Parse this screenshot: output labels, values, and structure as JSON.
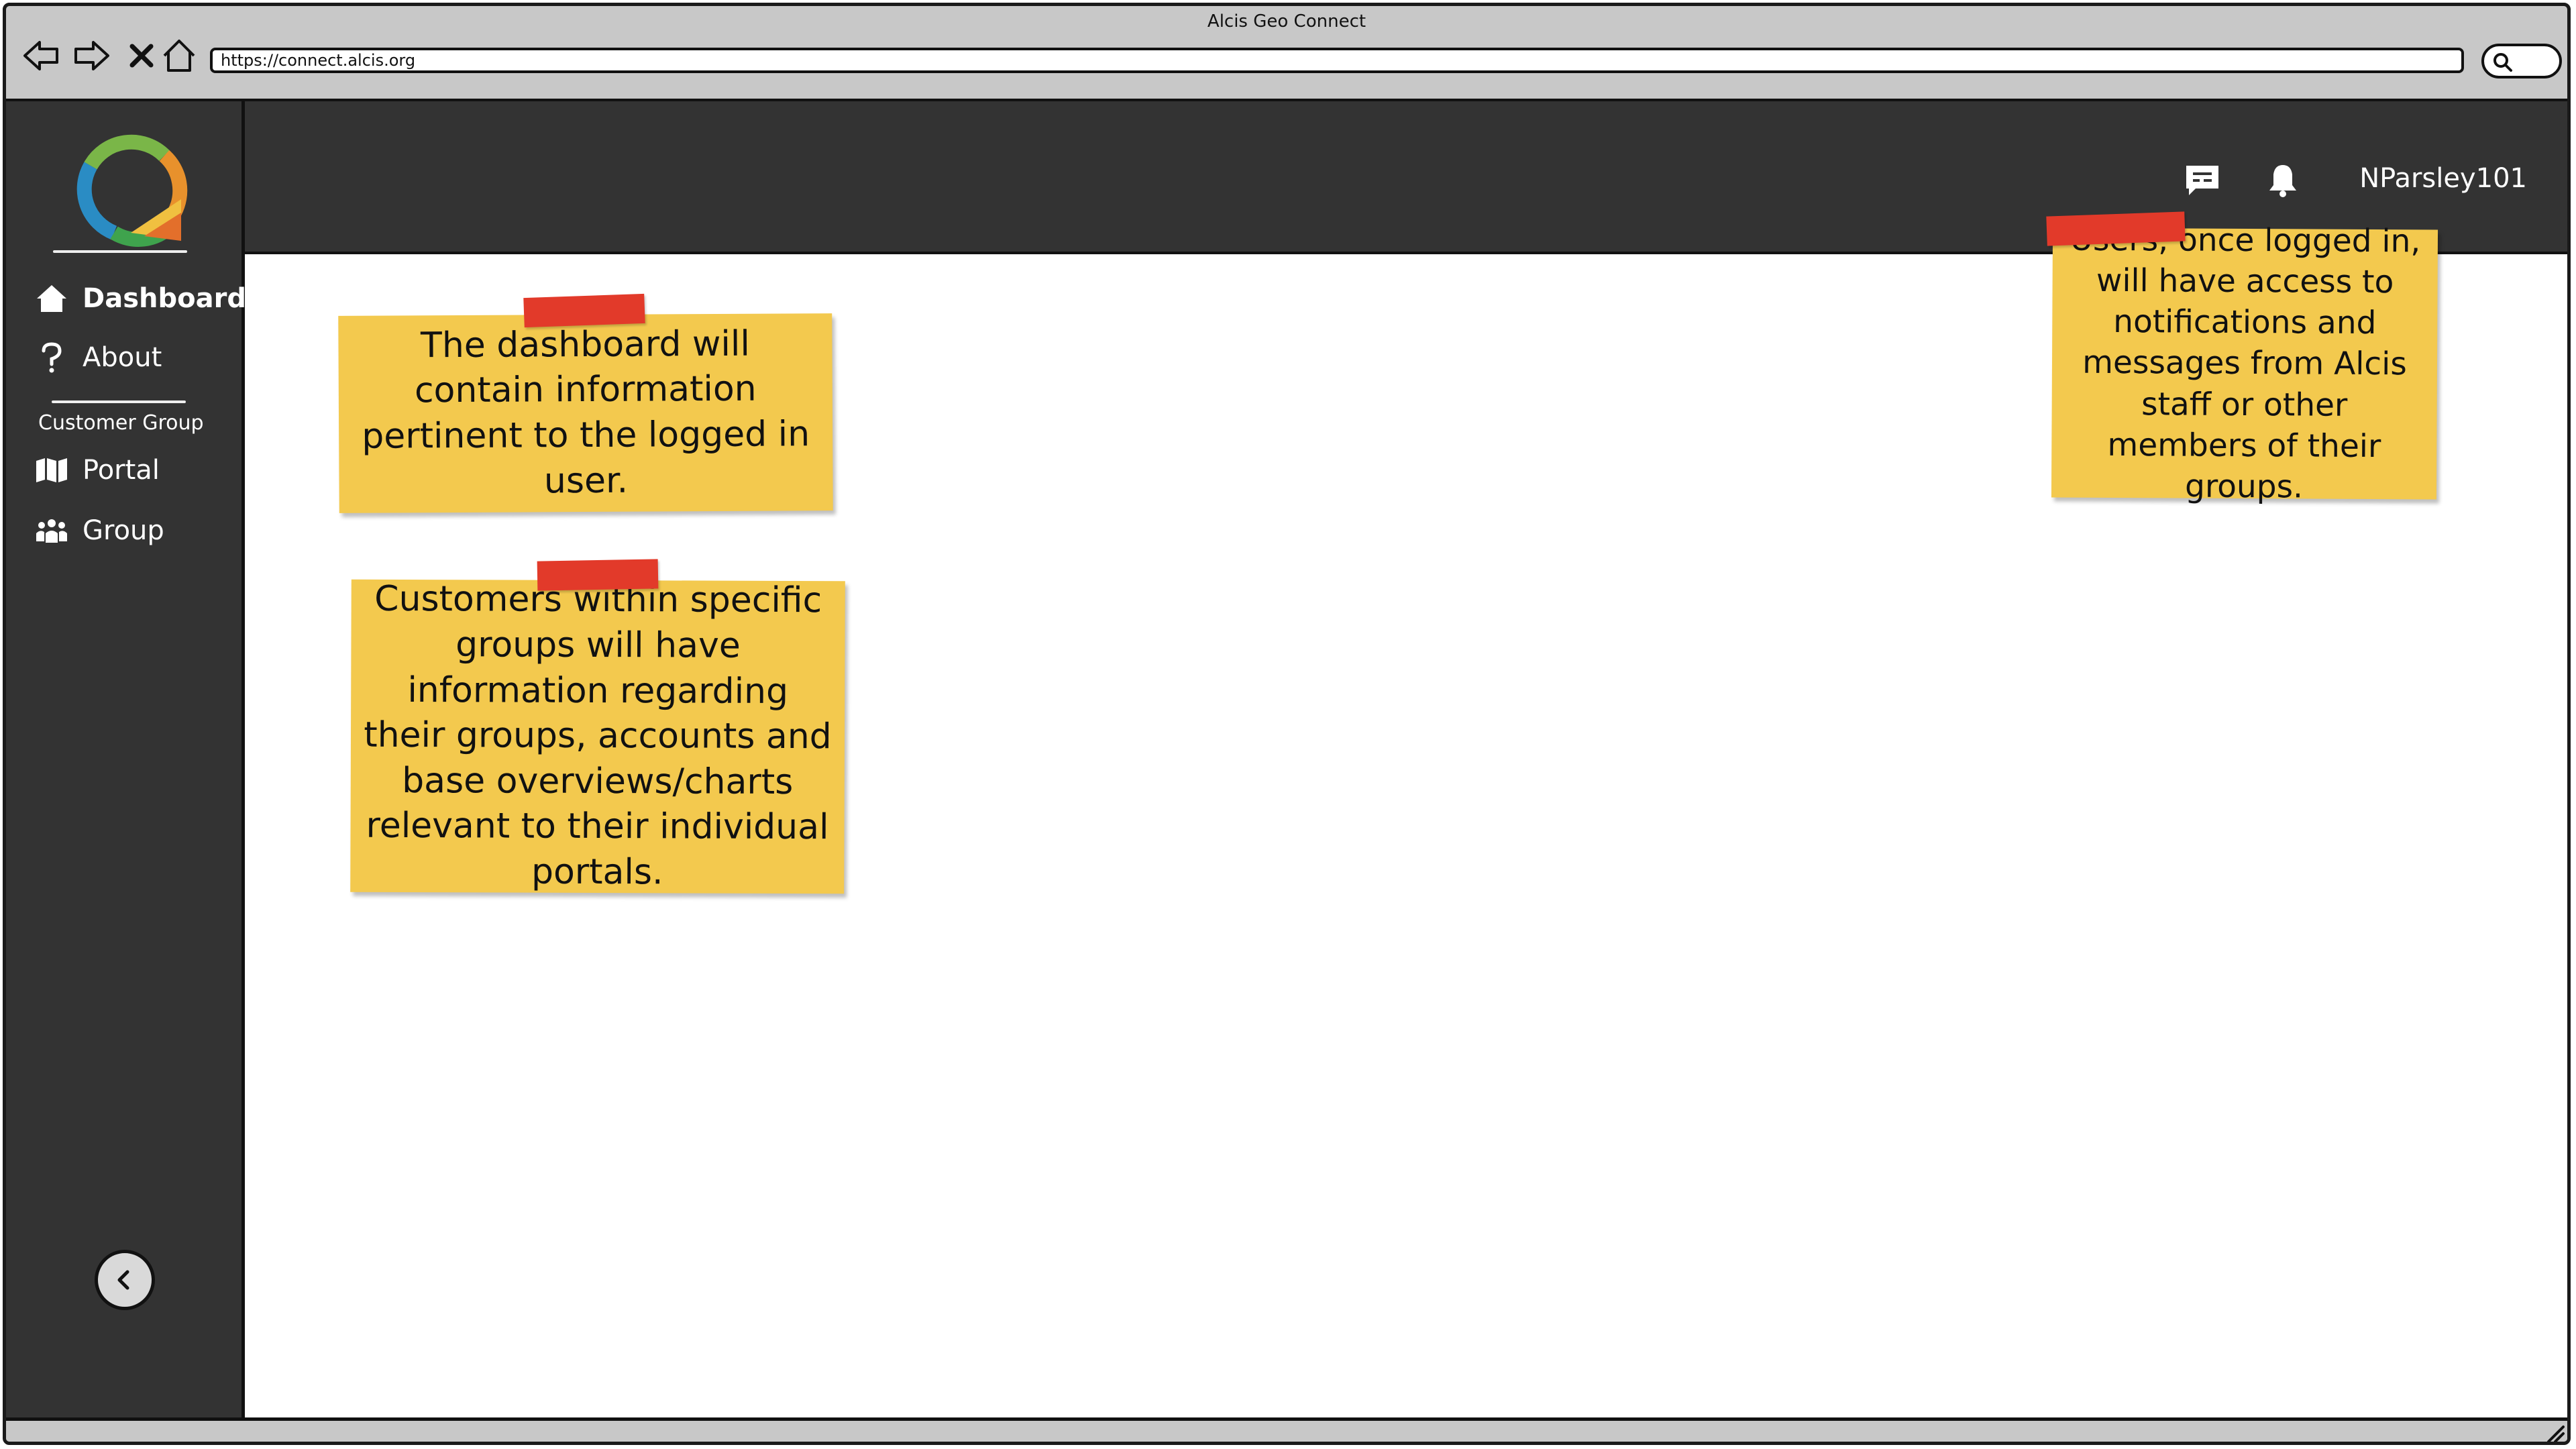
{
  "browser": {
    "window_title": "Alcis Geo Connect",
    "url": "https://connect.alcis.org",
    "nav_icons": [
      "back-arrow-icon",
      "forward-arrow-icon",
      "close-x-icon",
      "home-icon"
    ],
    "search_icon": "search-icon"
  },
  "sidebar": {
    "logo_icon": "alcis-logo",
    "items": [
      {
        "label": "Dashboard",
        "icon": "home-icon",
        "active": true
      },
      {
        "label": "About",
        "icon": "question-icon",
        "active": false
      }
    ],
    "section_label": "Customer Group",
    "section_items": [
      {
        "label": "Portal",
        "icon": "map-icon"
      },
      {
        "label": "Group",
        "icon": "people-icon"
      }
    ],
    "collapse_icon": "chevron-left-icon"
  },
  "topbar": {
    "username": "NParsley101",
    "icons": [
      "message-icon",
      "bell-icon"
    ]
  },
  "notes": [
    {
      "text": "The dashboard will contain information pertinent to the logged in user."
    },
    {
      "text": "Customers within specific groups will have information regarding their groups, accounts and base overviews/charts relevant to their individual portals."
    },
    {
      "text": "Users, once logged in, will have access to notifications and messages from Alcis staff or other members of their groups."
    }
  ],
  "colors": {
    "dark_panel": "#333333",
    "note_yellow": "#f3c94e",
    "tape_red": "#e23a2a",
    "chrome_gray": "#c8c8c8"
  }
}
